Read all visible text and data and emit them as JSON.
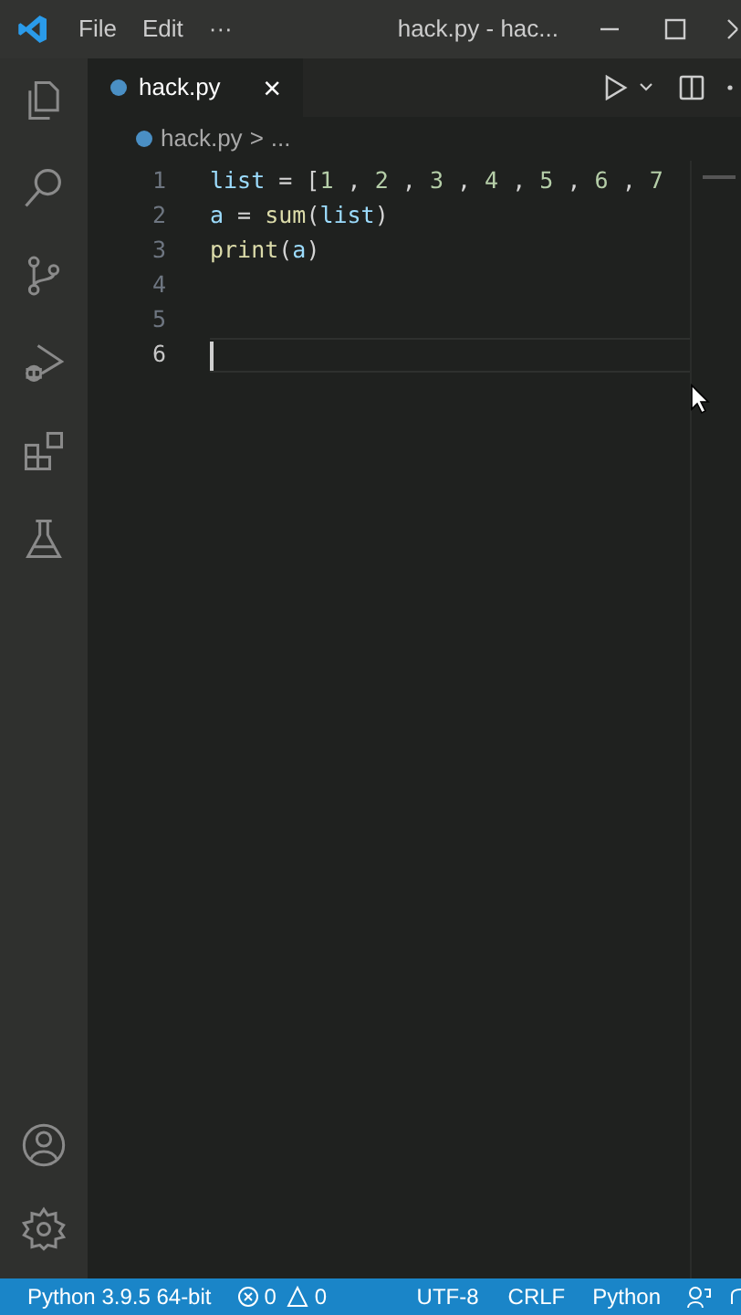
{
  "title_bar": {
    "menus": [
      "File",
      "Edit",
      "···"
    ],
    "title": "hack.py - hac..."
  },
  "tabs": [
    {
      "label": "hack.py",
      "close": "×",
      "selected": true
    }
  ],
  "breadcrumb": {
    "file": "hack.py",
    "separator": ">",
    "rest": "..."
  },
  "editor": {
    "lines": [
      {
        "number": "1",
        "cursor": false,
        "tokens": [
          {
            "text": "list",
            "kind": "variable"
          },
          {
            "text": " = [",
            "kind": "plain"
          },
          {
            "text": "1",
            "kind": "number"
          },
          {
            "text": " , ",
            "kind": "plain"
          },
          {
            "text": "2",
            "kind": "number"
          },
          {
            "text": " , ",
            "kind": "plain"
          },
          {
            "text": "3",
            "kind": "number"
          },
          {
            "text": " , ",
            "kind": "plain"
          },
          {
            "text": "4",
            "kind": "number"
          },
          {
            "text": " , ",
            "kind": "plain"
          },
          {
            "text": "5",
            "kind": "number"
          },
          {
            "text": " , ",
            "kind": "plain"
          },
          {
            "text": "6",
            "kind": "number"
          },
          {
            "text": " , ",
            "kind": "plain"
          },
          {
            "text": "7",
            "kind": "number"
          }
        ]
      },
      {
        "number": "2",
        "cursor": false,
        "tokens": [
          {
            "text": "a",
            "kind": "variable"
          },
          {
            "text": " = ",
            "kind": "plain"
          },
          {
            "text": "sum",
            "kind": "function"
          },
          {
            "text": "(",
            "kind": "plain"
          },
          {
            "text": "list",
            "kind": "variable"
          },
          {
            "text": ")",
            "kind": "plain"
          }
        ]
      },
      {
        "number": "3",
        "cursor": false,
        "tokens": [
          {
            "text": "print",
            "kind": "function"
          },
          {
            "text": "(",
            "kind": "plain"
          },
          {
            "text": "a",
            "kind": "variable"
          },
          {
            "text": ")",
            "kind": "plain"
          }
        ]
      },
      {
        "number": "4",
        "cursor": false
      },
      {
        "number": "5",
        "cursor": false
      },
      {
        "number": "6",
        "cursor": true
      }
    ]
  },
  "status_bar": {
    "interpreter": "Python 3.9.5 64-bit",
    "errors": "0",
    "warnings": "0",
    "encoding": "UTF-8",
    "line_ending": "CRLF",
    "language": "Python"
  }
}
